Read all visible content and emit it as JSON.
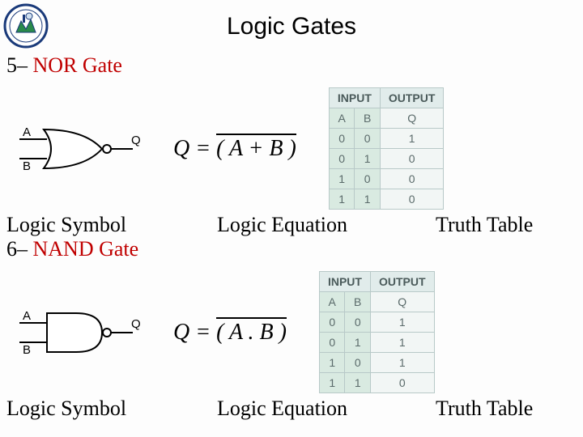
{
  "title": "Logic Gates",
  "logo_alt": "institution-crest",
  "nor": {
    "number": "5–",
    "name": "NOR Gate",
    "pins": {
      "a": "A",
      "b": "B",
      "q": "Q"
    },
    "equation_lhs": "Q =",
    "equation_rhs": "( A + B )",
    "labels": {
      "symbol": "Logic Symbol",
      "equation": "Logic Equation",
      "table": "Truth Table"
    },
    "truth": {
      "header_input": "INPUT",
      "header_output": "OUTPUT",
      "cols": {
        "a": "A",
        "b": "B",
        "q": "Q"
      },
      "rows": [
        {
          "a": "0",
          "b": "0",
          "q": "1"
        },
        {
          "a": "0",
          "b": "1",
          "q": "0"
        },
        {
          "a": "1",
          "b": "0",
          "q": "0"
        },
        {
          "a": "1",
          "b": "1",
          "q": "0"
        }
      ]
    }
  },
  "nand": {
    "number": "6–",
    "name": "NAND Gate",
    "pins": {
      "a": "A",
      "b": "B",
      "q": "Q"
    },
    "equation_lhs": "Q =",
    "equation_rhs": "( A . B )",
    "labels": {
      "symbol": "Logic Symbol",
      "equation": "Logic Equation",
      "table": "Truth Table"
    },
    "truth": {
      "header_input": "INPUT",
      "header_output": "OUTPUT",
      "cols": {
        "a": "A",
        "b": "B",
        "q": "Q"
      },
      "rows": [
        {
          "a": "0",
          "b": "0",
          "q": "1"
        },
        {
          "a": "0",
          "b": "1",
          "q": "1"
        },
        {
          "a": "1",
          "b": "0",
          "q": "1"
        },
        {
          "a": "1",
          "b": "1",
          "q": "0"
        }
      ]
    }
  }
}
